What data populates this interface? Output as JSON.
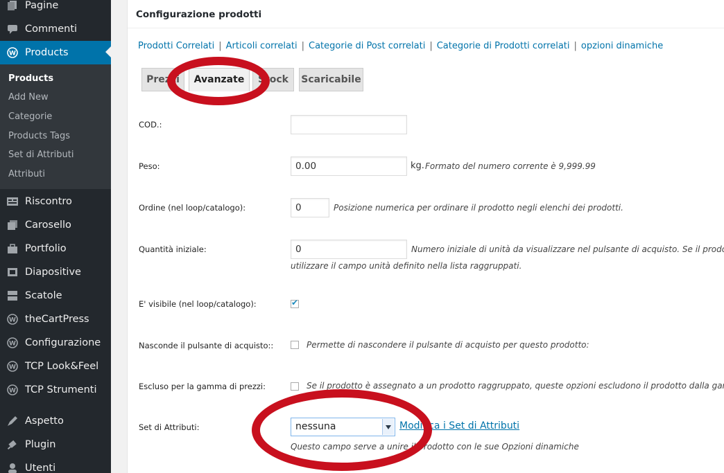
{
  "sidebar": {
    "items": [
      {
        "label": "Pagine",
        "icon": "pages-icon"
      },
      {
        "label": "Commenti",
        "icon": "comments-icon"
      },
      {
        "label": "Products",
        "icon": "wordpress-icon",
        "active": true
      },
      {
        "label": "Riscontro",
        "icon": "feedback-icon"
      },
      {
        "label": "Carosello",
        "icon": "carousel-icon"
      },
      {
        "label": "Portfolio",
        "icon": "portfolio-icon"
      },
      {
        "label": "Diapositive",
        "icon": "slides-icon"
      },
      {
        "label": "Scatole",
        "icon": "boxes-icon"
      },
      {
        "label": "theCartPress",
        "icon": "wordpress-icon"
      },
      {
        "label": "Configurazione",
        "icon": "wordpress-icon"
      },
      {
        "label": "TCP Look&Feel",
        "icon": "wordpress-icon"
      },
      {
        "label": "TCP Strumenti",
        "icon": "wordpress-icon"
      },
      {
        "label": "Aspetto",
        "icon": "appearance-icon"
      },
      {
        "label": "Plugin",
        "icon": "plugin-icon"
      },
      {
        "label": "Utenti",
        "icon": "users-icon"
      }
    ],
    "submenu": [
      {
        "label": "Products",
        "current": true
      },
      {
        "label": "Add New"
      },
      {
        "label": "Categorie"
      },
      {
        "label": "Products Tags"
      },
      {
        "label": "Set di Attributi"
      },
      {
        "label": "Attributi"
      }
    ]
  },
  "panel": {
    "title": "Configurazione prodotti",
    "related_links": [
      "Prodotti Correlati",
      "Articoli correlati",
      "Categorie di Post correlati",
      "Categorie di Prodotti correlati",
      "opzioni dinamiche"
    ],
    "separator": "|",
    "tabs": [
      "Prezzi",
      "Avanzate",
      "Stock",
      "Scaricabile"
    ],
    "active_tab": "Avanzate"
  },
  "form": {
    "cod": {
      "label": "COD.:",
      "value": ""
    },
    "peso": {
      "label": "Peso:",
      "value": "0.00",
      "unit": "kg.",
      "hint": "Formato del numero corrente è 9,999.99"
    },
    "ordine": {
      "label": "Ordine (nel loop/catalogo):",
      "value": "0",
      "hint": "Posizione numerica per ordinare il prodotto negli elenchi dei prodotti."
    },
    "quantita": {
      "label": "Quantità iniziale:",
      "value": "0",
      "hint": "Numero iniziale di unità da visualizzare nel pulsante di acquisto. Se il prodotto",
      "hint2": "utilizzare il campo unità definito nella lista raggruppati."
    },
    "visibile": {
      "label": "E' visibile (nel loop/catalogo):",
      "checked": true
    },
    "nasconde": {
      "label": "Nasconde il pulsante di acquisto::",
      "checked": false,
      "hint": "Permette di nascondere il pulsante di acquisto per questo prodotto:"
    },
    "escluso": {
      "label": "Escluso per la gamma di prezzi:",
      "checked": false,
      "hint": "Se il prodotto è assegnato a un prodotto raggruppato, queste opzioni escludono il prodotto dalla gamma"
    },
    "set_attributi": {
      "label": "Set di Attributi:",
      "selected": "nessuna",
      "link": "Modifica i Set di Attributi",
      "hint": "Questo campo serve a unire il prodotto con le sue Opzioni dinamiche"
    }
  },
  "annotations": {
    "color": "#c8101e"
  }
}
